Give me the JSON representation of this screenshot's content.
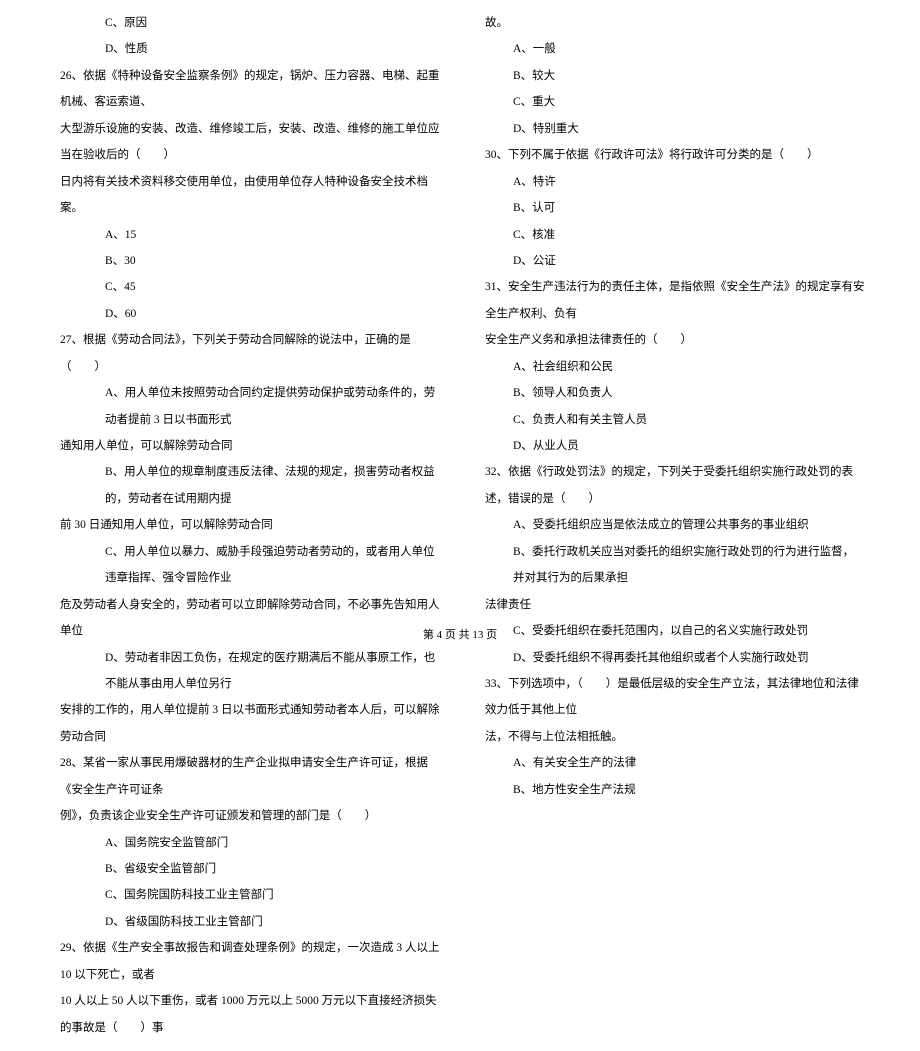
{
  "left": {
    "opt_c": "C、原因",
    "opt_d": "D、性质",
    "q26_a": "26、依据《特种设备安全监察条例》的规定，锅炉、压力容器、电梯、起重机械、客运索道、",
    "q26_b": "大型游乐设施的安装、改造、维修竣工后，安装、改造、维修的施工单位应当在验收后的（　　）",
    "q26_c": "日内将有关技术资料移交使用单位，由使用单位存人特种设备安全技术档案。",
    "q26_oa": "A、15",
    "q26_ob": "B、30",
    "q26_oc": "C、45",
    "q26_od": "D、60",
    "q27_a": "27、根据《劳动合同法》，下列关于劳动合同解除的说法中，正确的是（　　）",
    "q27_oa_1": "A、用人单位未按照劳动合同约定提供劳动保护或劳动条件的，劳动者提前 3 日以书面形式",
    "q27_oa_2": "通知用人单位，可以解除劳动合同",
    "q27_ob_1": "B、用人单位的规章制度违反法律、法规的规定，损害劳动者权益的，劳动者在试用期内提",
    "q27_ob_2": "前 30 日通知用人单位，可以解除劳动合同",
    "q27_oc_1": "C、用人单位以暴力、威胁手段强迫劳动者劳动的，或者用人单位违章指挥、强令冒险作业",
    "q27_oc_2": "危及劳动者人身安全的，劳动者可以立即解除劳动合同，不必事先告知用人单位",
    "q27_od_1": "D、劳动者非因工负伤，在规定的医疗期满后不能从事原工作，也不能从事由用人单位另行",
    "q27_od_2": "安排的工作的，用人单位提前 3 日以书面形式通知劳动者本人后，可以解除劳动合同",
    "q28_a": "28、某省一家从事民用爆破器材的生产企业拟申请安全生产许可证，根据《安全生产许可证条",
    "q28_b": "例》，负责该企业安全生产许可证颁发和管理的部门是（　　）",
    "q28_oa": "A、国务院安全监管部门",
    "q28_ob": "B、省级安全监管部门",
    "q28_oc": "C、国务院国防科技工业主管部门",
    "q28_od": "D、省级国防科技工业主管部门",
    "q29_a": "29、依据《生产安全事故报告和调查处理条例》的规定，一次造成 3 人以上 10 以下死亡，或者",
    "q29_b": "10 人以上 50 人以下重伤，或者 1000 万元以上 5000 万元以下直接经济损失的事故是（　　）事"
  },
  "right": {
    "q29_c": "故。",
    "q29_oa": "A、一般",
    "q29_ob": "B、较大",
    "q29_oc": "C、重大",
    "q29_od": "D、特别重大",
    "q30_a": "30、下列不属于依据《行政许可法》将行政许可分类的是（　　）",
    "q30_oa": "A、特许",
    "q30_ob": "B、认可",
    "q30_oc": "C、核准",
    "q30_od": "D、公证",
    "q31_a": "31、安全生产违法行为的责任主体，是指依照《安全生产法》的规定享有安全生产权利、负有",
    "q31_b": "安全生产义务和承担法律责任的（　　）",
    "q31_oa": "A、社会组织和公民",
    "q31_ob": "B、领导人和负责人",
    "q31_oc": "C、负责人和有关主管人员",
    "q31_od": "D、从业人员",
    "q32_a": "32、依据《行政处罚法》的规定，下列关于受委托组织实施行政处罚的表述，错误的是（　　）",
    "q32_oa": "A、受委托组织应当是依法成立的管理公共事务的事业组织",
    "q32_ob_1": "B、委托行政机关应当对委托的组织实施行政处罚的行为进行监督，并对其行为的后果承担",
    "q32_ob_2": "法律责任",
    "q32_oc": "C、受委托组织在委托范围内，以自己的名义实施行政处罚",
    "q32_od": "D、受委托组织不得再委托其他组织或者个人实施行政处罚",
    "q33_a": "33、下列选项中，（　　）是最低层级的安全生产立法，其法律地位和法律效力低于其他上位",
    "q33_b": "法，不得与上位法相抵触。",
    "q33_oa": "A、有关安全生产的法律",
    "q33_ob": "B、地方性安全生产法规"
  },
  "footer": "第 4 页 共 13 页"
}
